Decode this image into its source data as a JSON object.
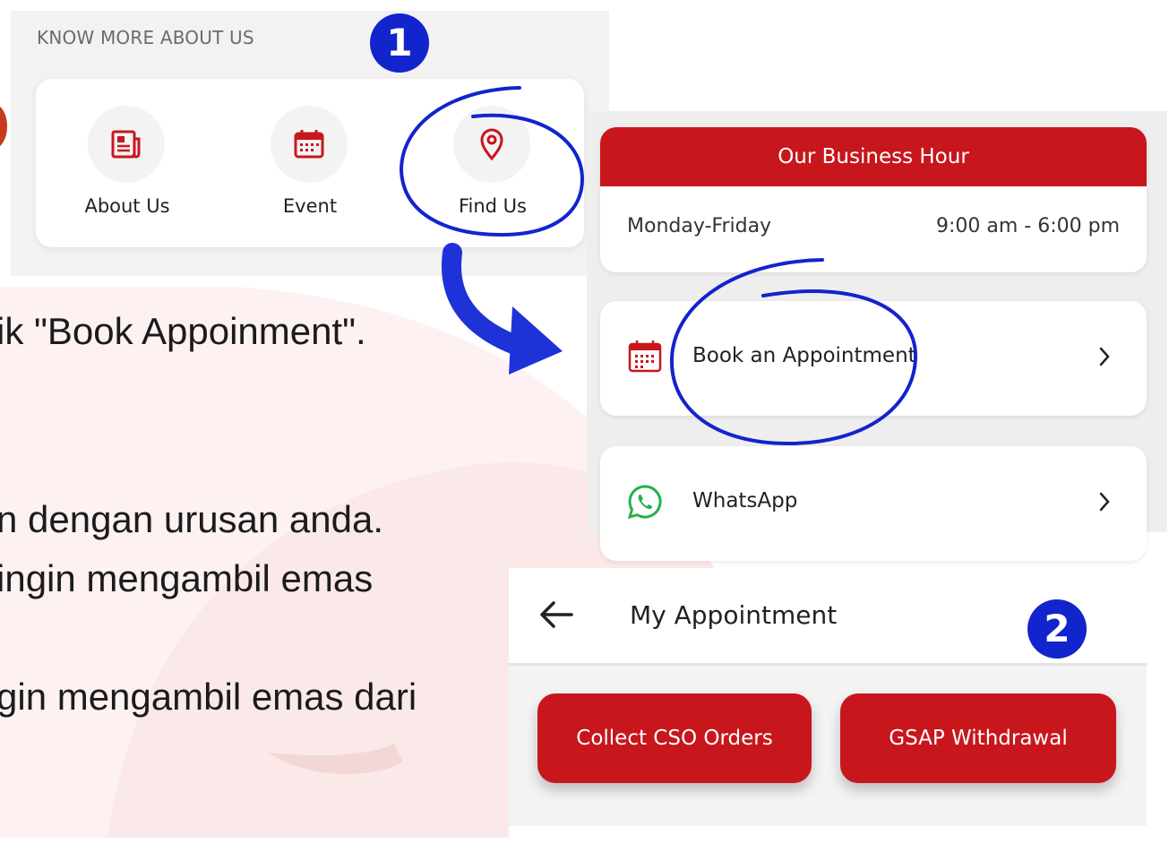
{
  "instructions": {
    "line1": "ik \"Book Appoinment\".",
    "line2": "n dengan urusan anda.",
    "line3": "ingin mengambil emas",
    "line4": "gin mengambil emas dari"
  },
  "know_more": {
    "header": "KNOW MORE ABOUT US",
    "items": [
      {
        "label": "About Us",
        "icon": "news-icon"
      },
      {
        "label": "Event",
        "icon": "calendar-icon"
      },
      {
        "label": "Find Us",
        "icon": "location-pin-icon"
      }
    ]
  },
  "business_hour": {
    "title": "Our Business Hour",
    "day": "Monday-Friday",
    "time": "9:00 am - 6:00 pm"
  },
  "actions": [
    {
      "label": "Book an Appointment",
      "icon": "calendar-icon"
    },
    {
      "label": "WhatsApp",
      "icon": "whatsapp-icon"
    }
  ],
  "appointment": {
    "title": "My Appointment",
    "buttons": [
      "Collect CSO Orders",
      "GSAP Withdrawal"
    ]
  },
  "badges": [
    "1",
    "2"
  ],
  "colors": {
    "brand_red": "#c8161d",
    "annotation_blue": "#1224cc"
  }
}
